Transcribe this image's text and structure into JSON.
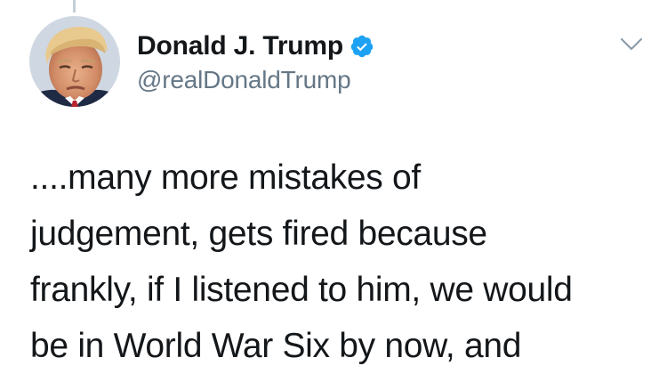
{
  "tweet": {
    "author": {
      "display_name": "Donald J. Trump",
      "handle": "@realDonaldTrump",
      "verified": true,
      "avatar_icon": "profile-photo"
    },
    "text_lines": [
      "....many more mistakes of",
      "judgement, gets fired because",
      "frankly, if I listened to him, we would",
      "be in World War Six by now, and"
    ],
    "menu_icon": "chevron-down-icon"
  },
  "colors": {
    "verified_badge": "#1da1f2",
    "handle_gray": "#657786",
    "text": "#14171a",
    "thread_line": "#c4cfd6"
  }
}
